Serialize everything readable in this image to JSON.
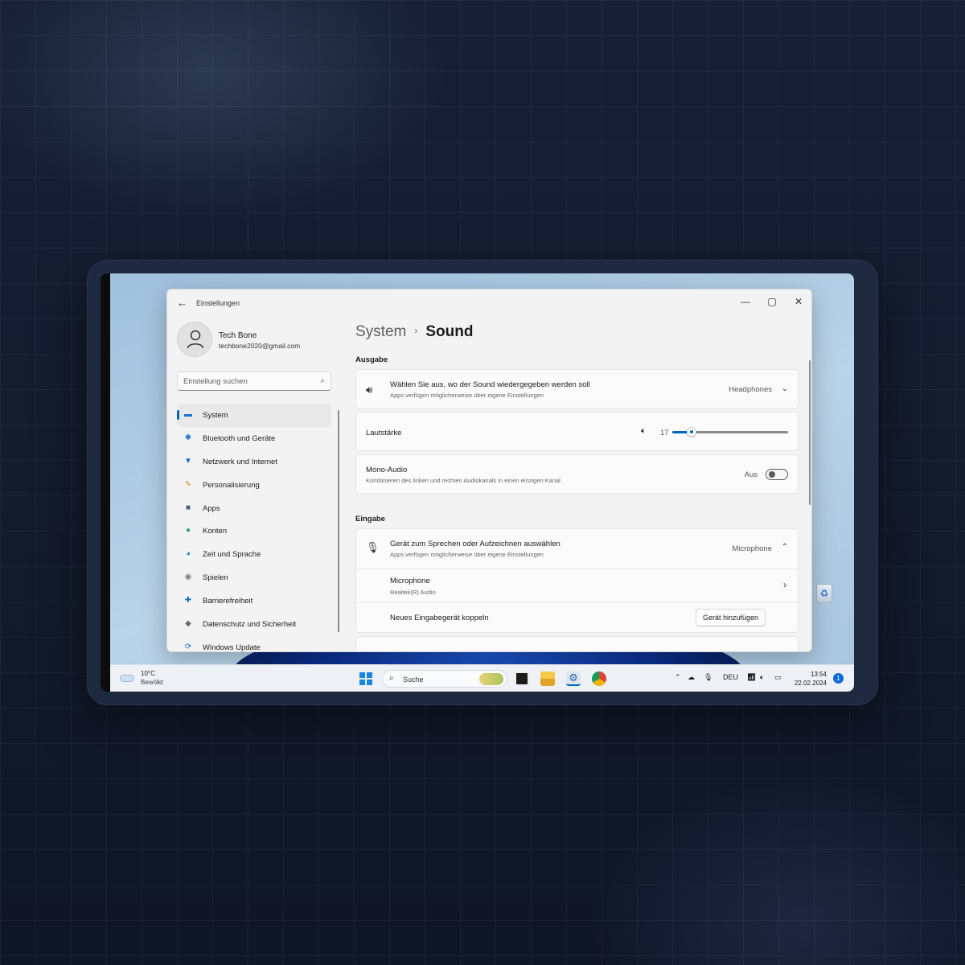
{
  "window": {
    "title": "Einstellungen",
    "controls": {
      "minimize": "—",
      "maximize": "▢",
      "close": "✕"
    }
  },
  "profile": {
    "name": "Tech Bone",
    "email": "techbone2020@gmail.com"
  },
  "search": {
    "placeholder": "Einstellung suchen"
  },
  "sidebar": {
    "items": [
      {
        "label": "System",
        "icon": "monitor-icon",
        "glyph": "▬",
        "color": "#1a73c8",
        "selected": true
      },
      {
        "label": "Bluetooth und Geräte",
        "icon": "bluetooth-icon",
        "glyph": "✱",
        "color": "#1a73c8"
      },
      {
        "label": "Netzwerk und Internet",
        "icon": "wifi-icon",
        "glyph": "▼",
        "color": "#1a73c8"
      },
      {
        "label": "Personalisierung",
        "icon": "brush-icon",
        "glyph": "✎",
        "color": "#d88a2a"
      },
      {
        "label": "Apps",
        "icon": "apps-icon",
        "glyph": "■",
        "color": "#4a5a78"
      },
      {
        "label": "Konten",
        "icon": "account-icon",
        "glyph": "●",
        "color": "#2aa37a"
      },
      {
        "label": "Zeit und Sprache",
        "icon": "globe-clock-icon",
        "glyph": "◕",
        "color": "#2b8ad6"
      },
      {
        "label": "Spielen",
        "icon": "gamepad-icon",
        "glyph": "◉",
        "color": "#7a7a7a"
      },
      {
        "label": "Barrierefreiheit",
        "icon": "accessibility-icon",
        "glyph": "✚",
        "color": "#1a73c8"
      },
      {
        "label": "Datenschutz und Sicherheit",
        "icon": "shield-icon",
        "glyph": "◆",
        "color": "#6b6b6b"
      },
      {
        "label": "Windows Update",
        "icon": "update-icon",
        "glyph": "⟳",
        "color": "#1a73c8"
      }
    ]
  },
  "breadcrumb": {
    "parent": "System",
    "separator": "›",
    "current": "Sound"
  },
  "output": {
    "section": "Ausgabe",
    "device": {
      "title": "Wählen Sie aus, wo der Sound wiedergegeben werden soll",
      "subtitle": "Apps verfügen möglicherweise über eigene Einstellungen",
      "value": "Headphones",
      "icon": "speaker-icon"
    },
    "volume": {
      "label": "Lautstärke",
      "value": "17",
      "level": 17
    },
    "mono": {
      "title": "Mono-Audio",
      "subtitle": "Kombinieren des linken und rechten Audiokanals in einen einzigen Kanal",
      "state": "Aus"
    }
  },
  "input": {
    "section": "Eingabe",
    "device": {
      "title": "Gerät zum Sprechen oder Aufzeichnen auswählen",
      "subtitle": "Apps verfügen möglicherweise über eigene Einstellungen",
      "value": "Microphone",
      "icon": "microphone-icon"
    },
    "microphone": {
      "title": "Microphone",
      "subtitle": "Realtek(R) Audio"
    },
    "pair": {
      "title": "Neues Eingabegerät koppeln",
      "button": "Gerät hinzufügen"
    }
  },
  "taskbar": {
    "weather": {
      "temp": "10°C",
      "desc": "Bewölkt"
    },
    "search": "Suche",
    "language": "DEU",
    "time": "13:54",
    "date": "22.02.2024",
    "notifications": "1"
  },
  "colors": {
    "accent": "#0067c0",
    "taskbar": "#eef1f6",
    "window": "#f3f3f3"
  }
}
